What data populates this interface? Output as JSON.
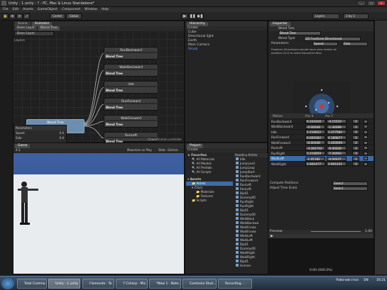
{
  "window": {
    "title": "Unity - 1.unity - ? - PC, Mac & Linux Standalone*"
  },
  "menu": [
    "File",
    "Edit",
    "Assets",
    "GameObject",
    "Component",
    "Window",
    "Help"
  ],
  "toolbar": {
    "pivot": "Center",
    "space": "Global",
    "layers": "Layers",
    "layout": "2 by 3"
  },
  "animator": {
    "tabs": [
      "Scene",
      "Animator"
    ],
    "breadcrumb": [
      "Base Layer",
      "Blend Tree"
    ],
    "layer": "Base Layer",
    "layers_label": "Layers",
    "nodes": [
      "RunBackward",
      "WalkBackward",
      "Idle",
      "RunForward",
      "WalkForward",
      "RunLeft"
    ],
    "node_sub": "Blend Tree",
    "blend_label": "Blend Tree",
    "params_header": "Parameters",
    "params": [
      {
        "name": "Speed",
        "value": "0.0"
      },
      {
        "name": "Side",
        "value": "0.0"
      }
    ],
    "footer": "Chars/Human.controller"
  },
  "hierarchy": {
    "tab": "Hierarchy",
    "create": "Create",
    "items": [
      "Cube",
      "Directional light",
      "Earth",
      "Main Camera",
      "Visual"
    ]
  },
  "game": {
    "tab": "Game",
    "aspect": "4:3",
    "options": [
      "Maximize on Play",
      "Stats",
      "Gizmos"
    ]
  },
  "project": {
    "tab": "Project",
    "create": "Create",
    "favorites": "Favorites",
    "fav_items": [
      "All Materials",
      "All Models",
      "All Prefabs",
      "All Scripts"
    ],
    "assets": "Assets",
    "tree": [
      "Anims",
      "Chars",
      "Materials",
      "Textures",
      "Scripts"
    ],
    "breadcrumb": "Assets ▸ Anims",
    "files": [
      "Idle",
      "JumpLand",
      "JumpLoop",
      "JumpStart",
      "RunBackward",
      "RunForward",
      "RunLeft",
      "RunLeft",
      "Bip01",
      "Dummy00",
      "RunRight",
      "RunRight",
      "Bip01",
      "Dummy00",
      "WalkBack",
      "WalkBackwa",
      "WalkForwa",
      "WalkForwa",
      "WalkLeft",
      "WalkLeft",
      "Bip01",
      "Dummy00",
      "WalkRight",
      "WalkRight",
      "Bip01",
      "Human"
    ]
  },
  "inspector": {
    "tab": "Inspector",
    "title": "Blend Tree",
    "name_field": "Blend Tree",
    "blend_type_label": "Blend Type",
    "blend_type": "2D Freeform Directional",
    "parameters_label": "Parameters",
    "param_x": "Speed",
    "param_y": "Side",
    "warning": "Freeform Directional should have zero motion at position (0,0) to avoid discontinuities.",
    "table_headers": [
      "Motion",
      "Pos X",
      "Pos Y",
      "",
      ""
    ],
    "rows": [
      {
        "motion": "RunBackward",
        "x": "0.333316",
        "y": "-4.15519",
        "t": "1"
      },
      {
        "motion": "WalkBackward",
        "x": "-0.00048",
        "y": "-1.40099",
        "t": "1"
      },
      {
        "motion": "Idle",
        "x": "1.216622",
        "y": "1.377582",
        "t": "1"
      },
      {
        "motion": "RunForward",
        "x": "0.009382",
        "y": "4.180877",
        "t": "1"
      },
      {
        "motion": "WalkForward",
        "x": "-0.00048",
        "y": "1.400009",
        "t": "1"
      },
      {
        "motion": "RunLeft",
        "x": "-3.282742",
        "y": "-0.00028",
        "t": "1"
      },
      {
        "motion": "RunRight",
        "x": "3.216859",
        "y": "-7.26093",
        "t": "1"
      },
      {
        "motion": "WalkLeft",
        "x": "-1.05182",
        "y": "-0.00037",
        "t": "1"
      },
      {
        "motion": "WalkRight",
        "x": "1.001477",
        "y": "2.901431",
        "t": "1"
      }
    ],
    "compute_label": "Compute Positions",
    "compute_value": "Select",
    "adjust_label": "Adjust Time Scale",
    "adjust_value": "Select",
    "preview_label": "Preview",
    "preview_speed": "1.00",
    "preview_time": "0:00 (000.0%)"
  },
  "taskbar": {
    "items": [
      "Total Comma...",
      "Unity - 1.unity",
      "Flamendo - To ...",
      "7 Csharp - Mic...",
      "*New 1 - Note...",
      "Camtasia Stud...",
      "Recording..."
    ],
    "desktop": "Рабочий стол",
    "lang": "EN",
    "time": "16:21"
  },
  "colors": {
    "accent": "#3b6ea8",
    "node_blue": "#6c8fb0",
    "sky": "#3a5c9e"
  }
}
